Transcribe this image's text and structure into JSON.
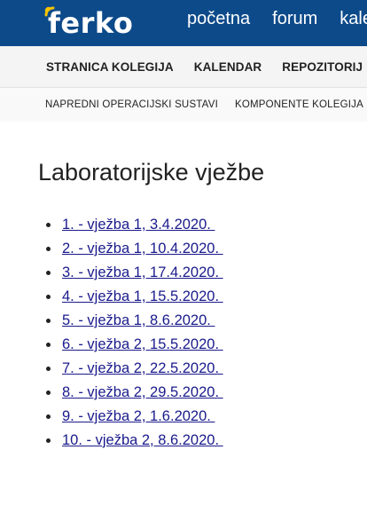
{
  "header": {
    "logo_text": "ferko",
    "nav": [
      "početna",
      "forum",
      "kalendar"
    ]
  },
  "course_nav": [
    "STRANICA KOLEGIJA",
    "KALENDAR",
    "REPOZITORIJ"
  ],
  "course_subnav": [
    "NAPREDNI OPERACIJSKI SUSTAVI",
    "KOMPONENTE KOLEGIJA"
  ],
  "main": {
    "title": "Laboratorijske vježbe",
    "labs": [
      "1. - vježba 1, 3.4.2020. ",
      "2. - vježba 1, 10.4.2020. ",
      "3. - vježba 1, 17.4.2020. ",
      "4. - vježba 1, 15.5.2020. ",
      "5. - vježba 1, 8.6.2020. ",
      "6. - vježba 2, 15.5.2020. ",
      "7. - vježba 2, 22.5.2020. ",
      "8. - vježba 2, 29.5.2020. ",
      "9. - vježba 2, 1.6.2020. ",
      "10. - vježba 2, 8.6.2020. "
    ]
  },
  "colors": {
    "header_bg": "#0d4a8a",
    "logo_accent": "#f5c400",
    "link": "#1a1a8c"
  },
  "icons": {
    "logo_mark": "signal-arc-icon"
  }
}
